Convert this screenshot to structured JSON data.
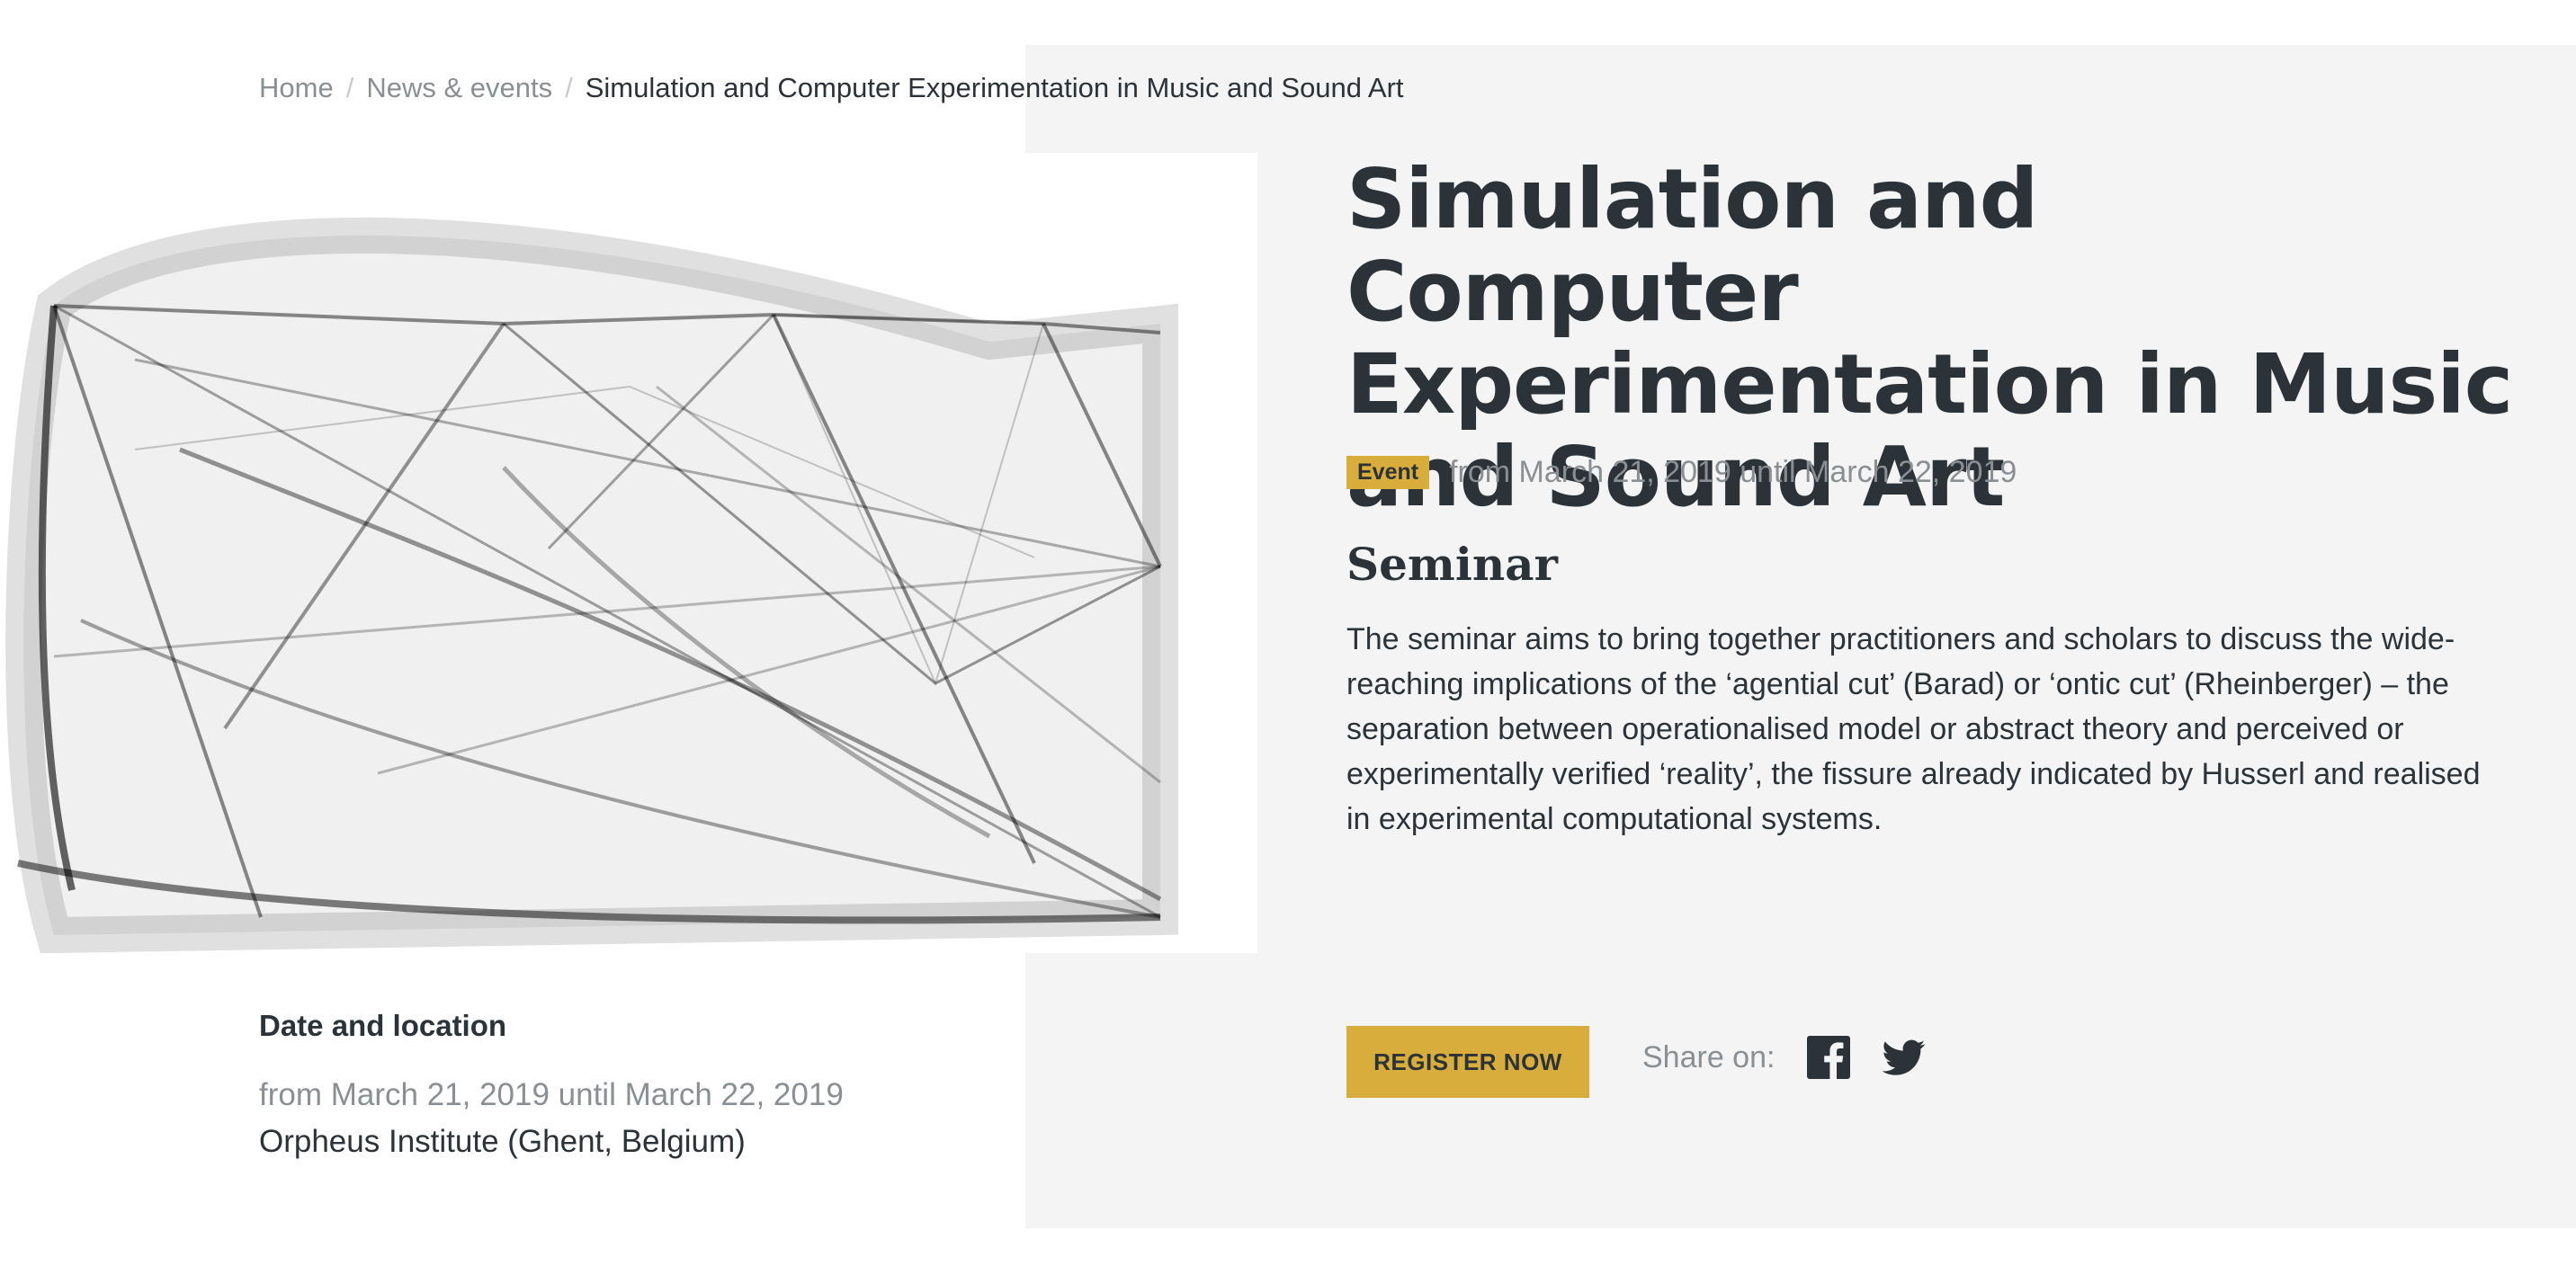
{
  "breadcrumb": {
    "home": "Home",
    "separator": "/",
    "news": "News & events",
    "current": "Simulation and Computer Experimentation in Music and Sound Art"
  },
  "event": {
    "title": "Simulation and Computer Experimentation in Music and Sound Art",
    "badge": "Event",
    "date_range": "from March 21, 2019 until March 22, 2019",
    "section_title": "Seminar",
    "description": "The seminar aims to bring together practitioners and scholars to discuss the wide-reaching implications of the ‘agential cut’ (Barad) or ‘ontic cut’ (Rheinberger) – the separation between operationalised model or abstract theory and perceived or experimentally verified ‘reality’, the fissure already indicated by Husserl and realised in experimental computational systems."
  },
  "actions": {
    "register_label": "REGISTER NOW",
    "share_label": "Share on:",
    "icons": [
      "facebook-icon",
      "twitter-icon"
    ]
  },
  "date_location": {
    "title": "Date and location",
    "date_range": "from March 21, 2019 until March 22, 2019",
    "location": "Orpheus Institute (Ghent, Belgium)"
  },
  "colors": {
    "accent": "#d9ad3c",
    "panel": "#f3f4f3",
    "text": "#2c3338",
    "muted": "#8a8f93"
  }
}
